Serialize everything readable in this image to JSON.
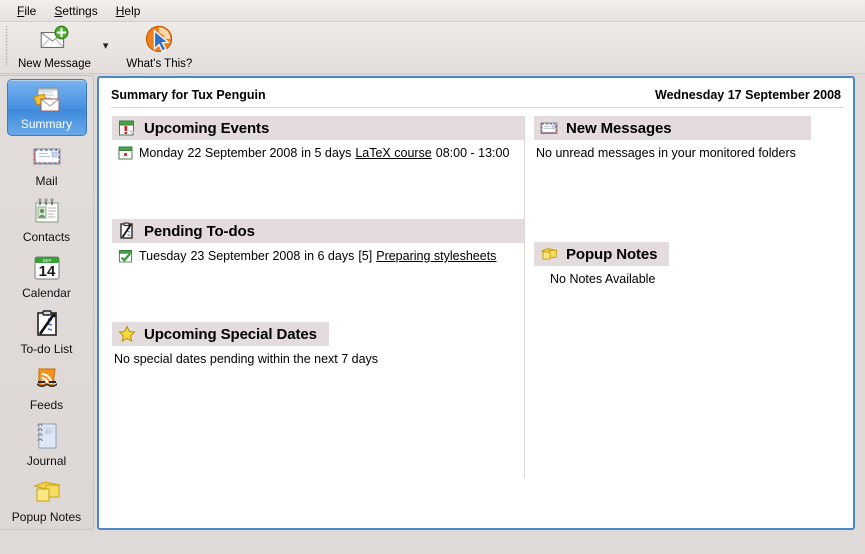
{
  "menubar": {
    "items": [
      {
        "label": "File",
        "accel": "F"
      },
      {
        "label": "Settings",
        "accel": "S"
      },
      {
        "label": "Help",
        "accel": "H"
      }
    ]
  },
  "toolbar": {
    "new_message_label": "New Message",
    "new_message_icon": "new-message-envelope-icon",
    "dropdown_icon": "chevron-down-icon",
    "whats_this_label": "What's This?",
    "whats_this_icon": "whats-this-cursor-icon"
  },
  "sidebar": {
    "items": [
      {
        "label": "Summary",
        "icon": "summary-icon",
        "selected": true
      },
      {
        "label": "Mail",
        "icon": "mail-envelope-icon",
        "selected": false
      },
      {
        "label": "Contacts",
        "icon": "contacts-card-icon",
        "selected": false
      },
      {
        "label": "Calendar",
        "icon": "calendar-icon",
        "day": "14",
        "month": "SEP",
        "selected": false
      },
      {
        "label": "To-do List",
        "icon": "todo-clipboard-icon",
        "selected": false
      },
      {
        "label": "Feeds",
        "icon": "rss-feeds-icon",
        "selected": false
      },
      {
        "label": "Journal",
        "icon": "journal-notebook-icon",
        "selected": false
      },
      {
        "label": "Popup Notes",
        "icon": "popup-notes-icon",
        "selected": false
      }
    ]
  },
  "panel": {
    "title": "Summary for Tux Penguin",
    "date": "Wednesday 17 September 2008",
    "left_column": {
      "upcoming_events": {
        "title": "Upcoming Events",
        "icon": "calendar-alert-icon",
        "rows": [
          {
            "icon": "calendar-day-icon",
            "weekday": "Monday",
            "date": "22 September 2008",
            "relative": "in 5 days",
            "link": "LaTeX course",
            "time": "08:00 - 13:00"
          }
        ]
      },
      "pending_todos": {
        "title": "Pending To-dos",
        "icon": "todo-clipboard-icon",
        "rows": [
          {
            "icon": "todo-check-icon",
            "weekday": "Tuesday",
            "date": "23 September 2008",
            "relative": "in 6 days",
            "count": "[5]",
            "link": "Preparing stylesheets"
          }
        ]
      },
      "special_dates": {
        "title": "Upcoming Special Dates",
        "icon": "star-icon",
        "empty_text": "No special dates pending within the next 7 days"
      }
    },
    "right_column": {
      "new_messages": {
        "title": "New Messages",
        "icon": "airmail-envelope-icon",
        "empty_text": "No unread messages in your monitored folders"
      },
      "popup_notes": {
        "title": "Popup Notes",
        "icon": "popup-notes-icon",
        "empty_text": "No Notes Available"
      }
    }
  },
  "colors": {
    "selection_blue": "#4e95e2",
    "panel_border": "#4b87c7",
    "section_band": "#e4dcdc",
    "window_bg": "#dedad8"
  }
}
